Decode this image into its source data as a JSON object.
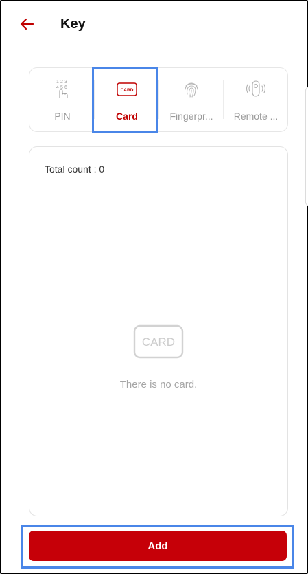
{
  "header": {
    "title": "Key",
    "back_icon": "back-arrow-icon"
  },
  "tabs": [
    {
      "label": "PIN",
      "icon": "keypad-icon",
      "active": false
    },
    {
      "label": "Card",
      "icon": "card-icon",
      "icon_text": "CARD",
      "active": true
    },
    {
      "label": "Fingerpr...",
      "icon": "fingerprint-icon",
      "active": false
    },
    {
      "label": "Remote ...",
      "icon": "remote-icon",
      "active": false
    }
  ],
  "list": {
    "count_text": "Total count : 0",
    "empty_icon_text": "CARD",
    "empty_message": "There is no card."
  },
  "actions": {
    "add_label": "Add"
  },
  "colors": {
    "accent": "#c60008",
    "highlight": "#4a86e8",
    "muted": "#9a9a9a"
  }
}
